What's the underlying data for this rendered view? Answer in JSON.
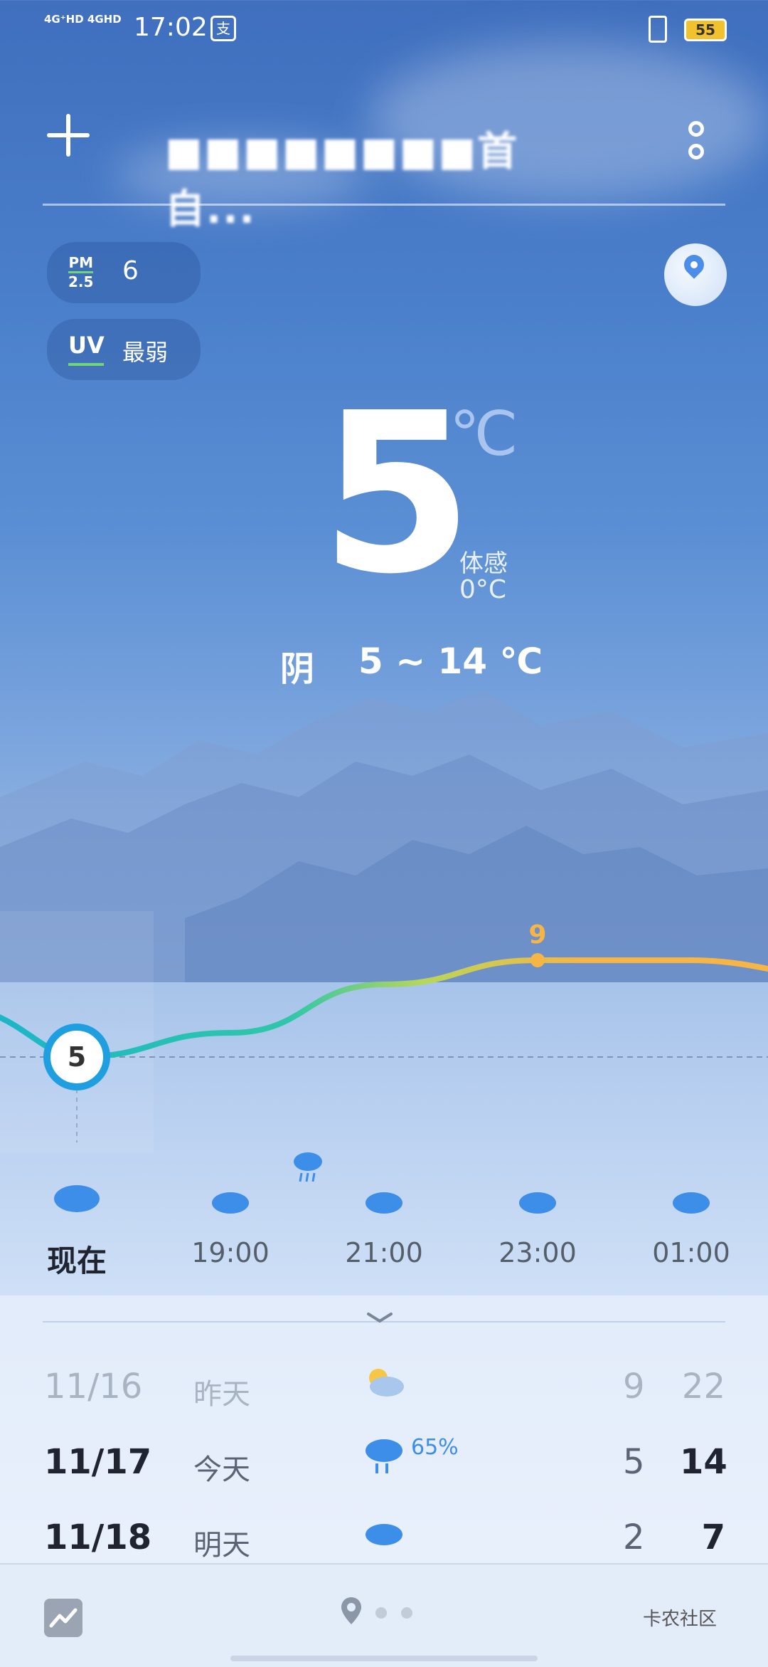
{
  "status_bar": {
    "network": "4G⁺HD 4GHD",
    "time": "17:02",
    "pay_icon": "alipay-icon",
    "battery": "55"
  },
  "header": {
    "city": "■■■■■■■■首自...",
    "add_icon": "plus-icon",
    "more_icon": "more-vertical-icon"
  },
  "air": {
    "pm_label_top": "PM",
    "pm_label_bottom": "2.5",
    "pm_value": "6",
    "uv_label": "UV",
    "uv_value": "最弱"
  },
  "current": {
    "temperature": "5",
    "unit": "℃",
    "feels_like_label": "体感",
    "feels_like": "0°C",
    "condition": "阴",
    "range": "5 ~ 14 ℃"
  },
  "chart_data": {
    "type": "line",
    "x": [
      "现在",
      "19:00",
      "21:00",
      "23:00",
      "01:00"
    ],
    "series": [
      {
        "values": [
          5,
          6,
          8,
          9,
          9
        ]
      }
    ],
    "annotations": [
      "5",
      "9"
    ]
  },
  "hourly": [
    {
      "label": "现在",
      "icon": "cloud-icon"
    },
    {
      "label": "19:00",
      "icon": "cloud-icon"
    },
    {
      "label": "21:00",
      "icon": "cloud-icon"
    },
    {
      "label": "23:00",
      "icon": "cloud-icon"
    },
    {
      "label": "01:00",
      "icon": "cloud-icon"
    }
  ],
  "daily": [
    {
      "date": "11/16",
      "day": "昨天",
      "icon": "partly-cloudy-icon",
      "precip": "",
      "low": "9",
      "high": "22"
    },
    {
      "date": "11/17",
      "day": "今天",
      "icon": "rain-icon",
      "precip": "65%",
      "low": "5",
      "high": "14"
    },
    {
      "date": "11/18",
      "day": "明天",
      "icon": "cloud-icon",
      "precip": "",
      "low": "2",
      "high": "7"
    }
  ],
  "bottom": {
    "trend_icon": "trend-icon",
    "location_icon": "location-icon",
    "watermark": "卡农社区"
  },
  "colors": {
    "accent": "#3c8ee8",
    "curve_cool": "#1cb5c8",
    "curve_warm": "#f6b544"
  }
}
